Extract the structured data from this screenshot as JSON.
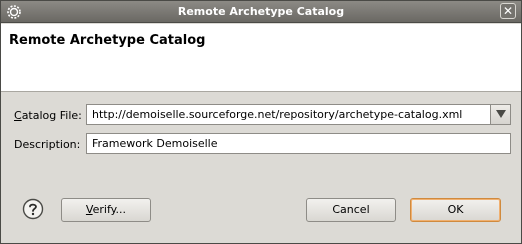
{
  "window": {
    "title": "Remote Archetype Catalog",
    "close_glyph": "✕"
  },
  "banner": {
    "title": "Remote Archetype Catalog"
  },
  "form": {
    "catalog_file_label_prefix": "C",
    "catalog_file_label_rest": "atalog File:",
    "catalog_file_value": "http://demoiselle.sourceforge.net/repository/archetype-catalog.xml",
    "description_label": "Description:",
    "description_value": "Framework Demoiselle"
  },
  "buttons": {
    "verify_prefix": "V",
    "verify_rest": "erify...",
    "cancel": "Cancel",
    "ok": "OK"
  },
  "icons": {
    "app": "eclipse-gear-icon",
    "help": "help-question-icon",
    "dropdown": "chevron-down-icon"
  }
}
